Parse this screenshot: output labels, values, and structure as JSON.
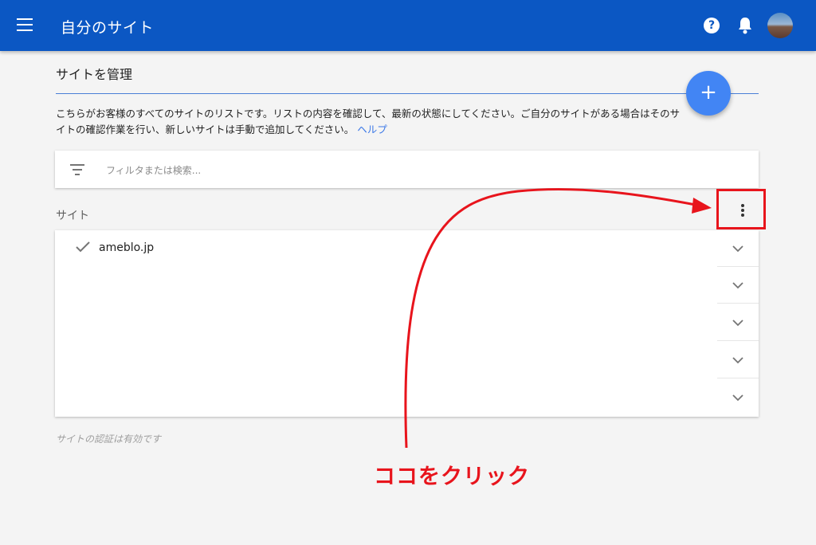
{
  "app_bar": {
    "title": "自分のサイト",
    "help_glyph": "?",
    "color": "#0b57c3"
  },
  "page": {
    "heading": "サイトを管理",
    "description": "こちらがお客様のすべてのサイトのリストです。リストの内容を確認して、最新の状態にしてください。ご自分のサイトがある場合はそのサイトの確認作業を行い、新しいサイトは手動で追加してください。",
    "help_link": "ヘルプ",
    "fab_label": "+"
  },
  "filter": {
    "placeholder": "フィルタまたは検索..."
  },
  "sites_section": {
    "label": "サイト",
    "items": [
      {
        "name": "ameblo.jp",
        "verified_icon": "check-icon"
      }
    ],
    "footer_note": "サイトの認証は有効です"
  },
  "annotation": {
    "text": "ココをクリック",
    "color": "#e8141c"
  },
  "colors": {
    "accent": "#4285f4",
    "link": "#3b78e7",
    "annotation": "#e8141c"
  }
}
